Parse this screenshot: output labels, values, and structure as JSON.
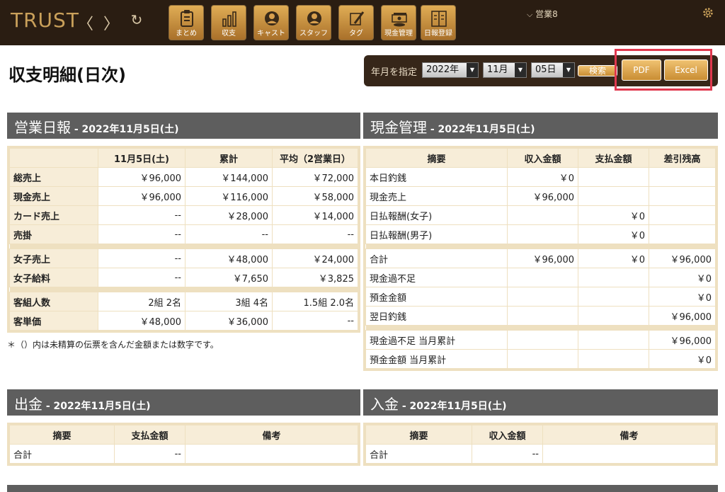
{
  "app": {
    "logo": "TRUST",
    "store": "営業8"
  },
  "nav": {
    "back": "〈",
    "forward": "〉",
    "reload": "↻",
    "items": [
      {
        "label": "まとめ",
        "icon": "clipboard-icon"
      },
      {
        "label": "収支",
        "icon": "bar-chart-icon"
      },
      {
        "label": "キャスト",
        "icon": "cast-person-icon"
      },
      {
        "label": "スタッフ",
        "icon": "staff-person-icon"
      },
      {
        "label": "タグ",
        "icon": "tag-pencil-icon"
      },
      {
        "label": "現金管理",
        "icon": "cash-icon"
      },
      {
        "label": "日報登録",
        "icon": "book-icon"
      }
    ]
  },
  "page": {
    "title": "収支明細(日次)"
  },
  "filter": {
    "label": "年月を指定",
    "year": "2022年",
    "month": "11月",
    "day": "05日",
    "search": "検索",
    "pdf": "PDF",
    "excel": "Excel"
  },
  "daily": {
    "title": "営業日報",
    "date": " - 2022年11月5日(土)",
    "headers": [
      "",
      "11月5日(土)",
      "累計",
      "平均（2営業日）"
    ],
    "rows": [
      [
        "総売上",
        "￥96,000",
        "￥144,000",
        "￥72,000"
      ],
      [
        "現金売上",
        "￥96,000",
        "￥116,000",
        "￥58,000"
      ],
      [
        "カード売上",
        "--",
        "￥28,000",
        "￥14,000"
      ],
      [
        "売掛",
        "--",
        "--",
        "--"
      ],
      [
        "女子売上",
        "--",
        "￥48,000",
        "￥24,000"
      ],
      [
        "女子給料",
        "--",
        "￥7,650",
        "￥3,825"
      ],
      [
        "客組人数",
        "2組 2名",
        "3組 4名",
        "1.5組 2.0名"
      ],
      [
        "客単価",
        "￥48,000",
        "￥36,000",
        "--"
      ]
    ],
    "note": "＊（）内は未精算の伝票を含んだ金額または数字です。"
  },
  "cash": {
    "title": "現金管理",
    "date": " - 2022年11月5日(土)",
    "headers": [
      "摘要",
      "収入金額",
      "支払金額",
      "差引残高"
    ],
    "rows": [
      [
        "本日釣銭",
        "￥0",
        "",
        ""
      ],
      [
        "現金売上",
        "￥96,000",
        "",
        ""
      ],
      [
        "日払報酬(女子)",
        "",
        "￥0",
        ""
      ],
      [
        "日払報酬(男子)",
        "",
        "￥0",
        ""
      ],
      [
        "合計",
        "￥96,000",
        "￥0",
        "￥96,000"
      ],
      [
        "現金過不足",
        "",
        "",
        "￥0"
      ],
      [
        "預金金額",
        "",
        "",
        "￥0"
      ],
      [
        "翌日釣銭",
        "",
        "",
        "￥96,000"
      ],
      [
        "現金過不足 当月累計",
        "",
        "",
        "￥96,000"
      ],
      [
        "預金金額 当月累計",
        "",
        "",
        "￥0"
      ]
    ]
  },
  "withdraw": {
    "title": "出金",
    "date": " - 2022年11月5日(土)",
    "headers": [
      "摘要",
      "支払金額",
      "備考"
    ],
    "rows": [
      [
        "合計",
        "--",
        ""
      ]
    ]
  },
  "deposit": {
    "title": "入金",
    "date": " - 2022年11月5日(土)",
    "headers": [
      "摘要",
      "収入金額",
      "備考"
    ],
    "rows": [
      [
        "合計",
        "--",
        ""
      ]
    ]
  },
  "colors": {
    "topbar": "#2a1d12",
    "gold": "#c9a05a",
    "section": "#5e5e5e",
    "cellBg": "#f7edd8",
    "highlight": "#e0384e"
  }
}
